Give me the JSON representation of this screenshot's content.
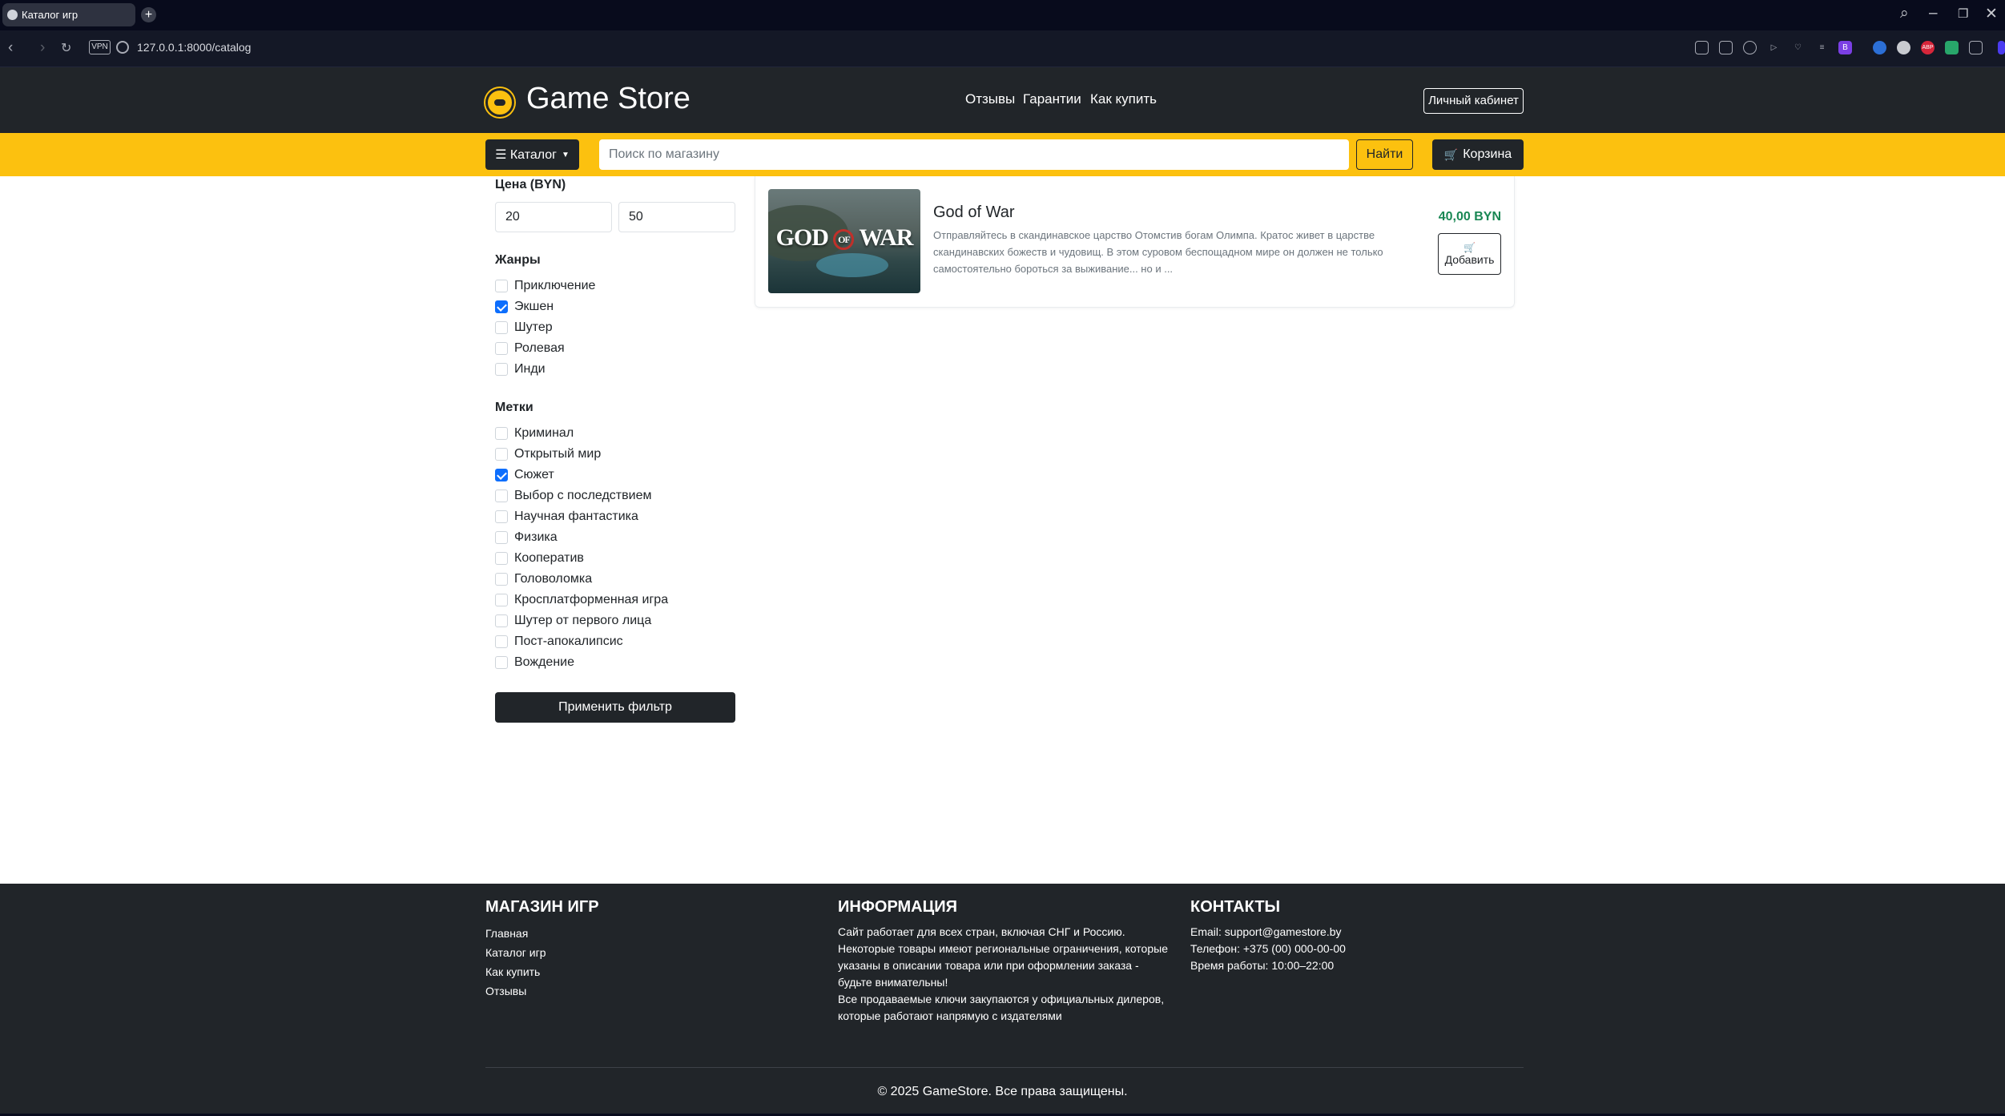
{
  "browser": {
    "tab_title": "Каталог игр",
    "url": "127.0.0.1:8000/catalog",
    "vpn_label": "VPN"
  },
  "header": {
    "logo_text": "Game Store",
    "nav": [
      "Отзывы",
      "Гарантии",
      "Как купить"
    ],
    "cabinet_label": "Личный кабинет"
  },
  "toolbar": {
    "catalog_label": "☰ Каталог",
    "search_placeholder": "Поиск по магазину",
    "find_label": "Найти",
    "cart_label": "Корзина"
  },
  "filters": {
    "price_label": "Цена (BYN)",
    "price_min": "20",
    "price_max": "50",
    "genres_label": "Жанры",
    "genres": [
      {
        "label": "Приключение",
        "checked": false
      },
      {
        "label": "Экшен",
        "checked": true
      },
      {
        "label": "Шутер",
        "checked": false
      },
      {
        "label": "Ролевая",
        "checked": false
      },
      {
        "label": "Инди",
        "checked": false
      }
    ],
    "tags_label": "Метки",
    "tags": [
      {
        "label": "Криминал",
        "checked": false
      },
      {
        "label": "Открытый мир",
        "checked": false
      },
      {
        "label": "Сюжет",
        "checked": true
      },
      {
        "label": "Выбор с последствием",
        "checked": false
      },
      {
        "label": "Научная фантастика",
        "checked": false
      },
      {
        "label": "Физика",
        "checked": false
      },
      {
        "label": "Кооператив",
        "checked": false
      },
      {
        "label": "Головоломка",
        "checked": false
      },
      {
        "label": "Кросплатформенная игра",
        "checked": false
      },
      {
        "label": "Шутер от первого лица",
        "checked": false
      },
      {
        "label": "Пост-апокалипсис",
        "checked": false
      },
      {
        "label": "Вождение",
        "checked": false
      }
    ],
    "apply_label": "Применить фильтр"
  },
  "products": [
    {
      "title": "God of War",
      "description": "Отправляйтесь в скандинавское царство Отомстив богам Олимпа. Кратос живет в царстве скандинавских божеств и чудовищ. В этом суровом беспощадном мире он должен не только самостоятельно бороться за выживание... но и ...",
      "price": "40,00 BYN",
      "add_label": "Добавить",
      "image_text_left": "GOD",
      "image_text_of": "OF",
      "image_text_right": "WAR"
    }
  ],
  "footer": {
    "col1_title": "МАГАЗИН ИГР",
    "col1_links": [
      "Главная",
      "Каталог игр",
      "Как купить",
      "Отзывы"
    ],
    "col2_title": "ИНФОРМАЦИЯ",
    "col2_lines": [
      "Сайт работает для всех стран, включая СНГ и Россию.",
      "Некоторые товары имеют региональные ограничения, которые",
      "указаны в описании товара или при оформлении заказа -",
      "будьте внимательны!",
      "Все продаваемые ключи закупаются у официальных дилеров,",
      "которые работают напрямую с издателями"
    ],
    "col3_title": "КОНТАКТЫ",
    "col3_lines": [
      "Email: support@gamestore.by",
      "Телефон: +375 (00) 000-00-00",
      "Время работы: 10:00–22:00"
    ],
    "copyright": "© 2025 GameStore. Все права защищены."
  },
  "colors": {
    "accent_yellow": "#fcc10f",
    "dark": "#212529",
    "price_green": "#198754",
    "checkbox_blue": "#0d6efd"
  }
}
